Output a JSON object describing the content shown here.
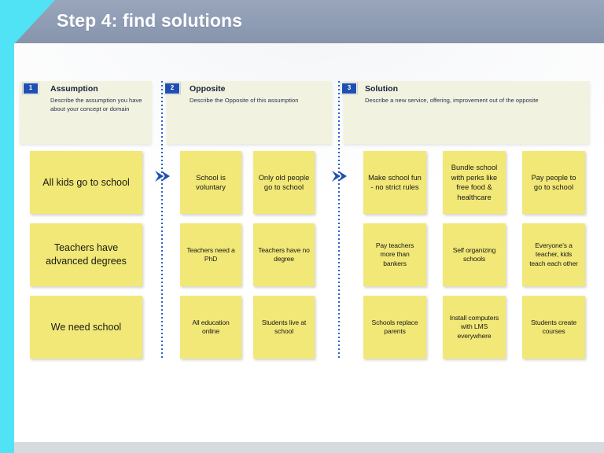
{
  "slide": {
    "title": "Step 4: find solutions",
    "colors": {
      "header_bar": "#8e9cb4",
      "accent_cyan": "#4fe3f5",
      "badge_blue": "#1f4fb0",
      "card_yellow": "#f2e878",
      "band_cream": "#f2f2e0",
      "bottom_strip": "#d6dbe0"
    }
  },
  "columns": [
    {
      "number": "1",
      "heading": "Assumption",
      "description": "Describe the assumption you have about your concept or domain"
    },
    {
      "number": "2",
      "heading": "Opposite",
      "description": "Describe the Opposite of this assumption"
    },
    {
      "number": "3",
      "heading": "Solution",
      "description": "Describe a new service, offering, improvement out of the opposite"
    }
  ],
  "rows": [
    {
      "assumption": "All kids go to school",
      "opposites": [
        "School is voluntary",
        "Only old people go to school"
      ],
      "solutions": [
        "Make school fun - no strict rules",
        "Bundle school with perks like free food & healthcare",
        "Pay people to go to school"
      ]
    },
    {
      "assumption": "Teachers have advanced degrees",
      "opposites": [
        "Teachers need a PhD",
        "Teachers have no degree"
      ],
      "solutions": [
        "Pay teachers more than bankers",
        "Self organizing schools",
        "Everyone's a teacher, kids teach each other"
      ]
    },
    {
      "assumption": "We need school",
      "opposites": [
        "All education online",
        "Students live at school"
      ],
      "solutions": [
        "Schools replace parents",
        "Install computers with LMS everywhere",
        "Students create courses"
      ]
    }
  ],
  "connectors": {
    "arrow_1_name": "chevron-right-icon",
    "arrow_2_name": "chevron-right-icon"
  }
}
